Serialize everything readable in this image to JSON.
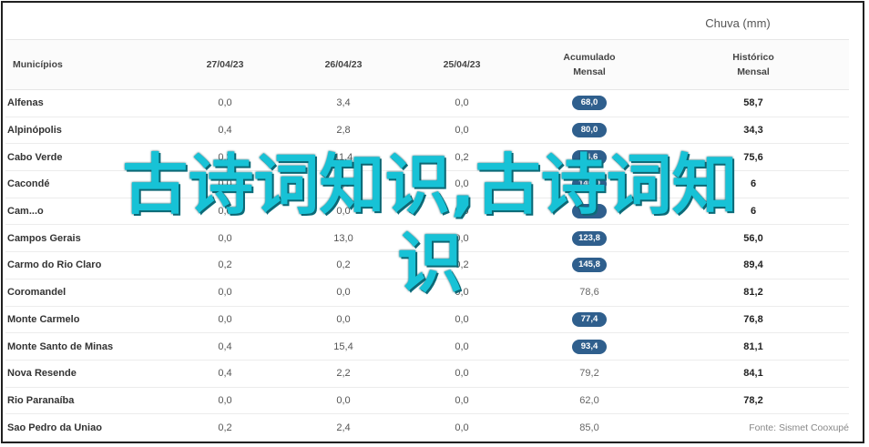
{
  "chart_title": "Chuva (mm)",
  "source": "Fonte: Sismet Cooxupé",
  "headers": {
    "municipio": "Municípios",
    "d1": "27/04/23",
    "d2": "26/04/23",
    "d3": "25/04/23",
    "acumulado_l1": "Acumulado",
    "acumulado_l2": "Mensal",
    "historico_l1": "Histórico",
    "historico_l2": "Mensal"
  },
  "pill_color": "#2f5f8d",
  "watermark": {
    "line1": "古诗词知识,古诗词知",
    "line2": "识"
  },
  "rows": [
    {
      "name": "Alfenas",
      "d1": "0,0",
      "d2": "3,4",
      "d3": "0,0",
      "acum": "68,0",
      "pill": true,
      "hist": "58,7"
    },
    {
      "name": "Alpinópolis",
      "d1": "0,4",
      "d2": "2,8",
      "d3": "0,0",
      "acum": "80,0",
      "pill": true,
      "hist": "34,3"
    },
    {
      "name": "Cabo Verde",
      "d1": "0,2",
      "d2": "11,4",
      "d3": "0,2",
      "acum": "94,6",
      "pill": true,
      "hist": "75,6"
    },
    {
      "name": "Cacondé",
      "d1": "0,0",
      "d2": "0,0",
      "d3": "0,0",
      "acum": "140,0",
      "pill": true,
      "hist": "6"
    },
    {
      "name": "Cam...o",
      "d1": "0,0",
      "d2": "0,0",
      "d3": "0,0",
      "acum": "2,0",
      "pill": true,
      "hist": "6"
    },
    {
      "name": "Campos Gerais",
      "d1": "0,0",
      "d2": "13,0",
      "d3": "0,0",
      "acum": "123,8",
      "pill": true,
      "hist": "56,0"
    },
    {
      "name": "Carmo do Rio Claro",
      "d1": "0,2",
      "d2": "0,2",
      "d3": "0,2",
      "acum": "145,8",
      "pill": true,
      "hist": "89,4"
    },
    {
      "name": "Coromandel",
      "d1": "0,0",
      "d2": "0,0",
      "d3": "0,0",
      "acum": "78,6",
      "pill": false,
      "hist": "81,2"
    },
    {
      "name": "Monte Carmelo",
      "d1": "0,0",
      "d2": "0,0",
      "d3": "0,0",
      "acum": "77,4",
      "pill": true,
      "hist": "76,8"
    },
    {
      "name": "Monte Santo de Minas",
      "d1": "0,4",
      "d2": "15,4",
      "d3": "0,0",
      "acum": "93,4",
      "pill": true,
      "hist": "81,1"
    },
    {
      "name": "Nova Resende",
      "d1": "0,4",
      "d2": "2,2",
      "d3": "0,0",
      "acum": "79,2",
      "pill": false,
      "hist": "84,1"
    },
    {
      "name": "Rio Paranaíba",
      "d1": "0,0",
      "d2": "0,0",
      "d3": "0,0",
      "acum": "62,0",
      "pill": false,
      "hist": "78,2"
    },
    {
      "name": "Sao Pedro da Uniao",
      "d1": "0,2",
      "d2": "2,4",
      "d3": "0,0",
      "acum": "85,0",
      "pill": false,
      "hist": ""
    }
  ]
}
